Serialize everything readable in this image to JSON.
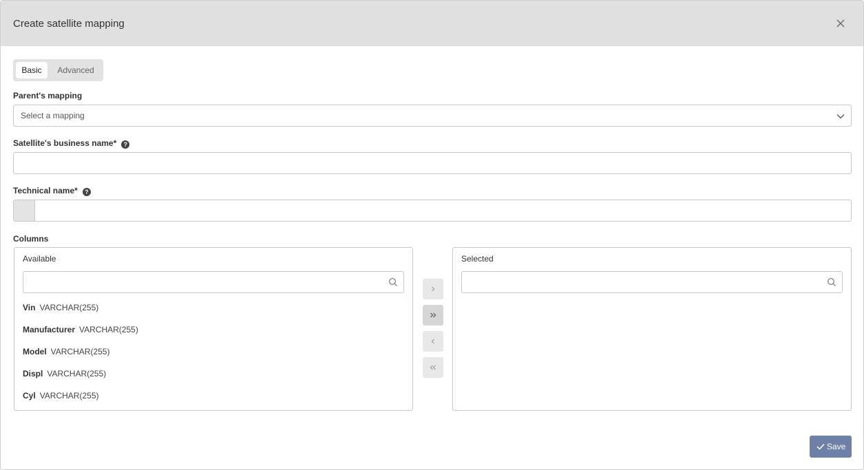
{
  "dialog": {
    "title": "Create satellite mapping",
    "close_icon": "close-icon"
  },
  "tabs": [
    {
      "label": "Basic",
      "active": true
    },
    {
      "label": "Advanced",
      "active": false
    }
  ],
  "fields": {
    "parent_mapping": {
      "label": "Parent's mapping",
      "placeholder": "Select a mapping",
      "value": ""
    },
    "business_name": {
      "label": "Satellite's business name*",
      "value": "",
      "help_icon": "?"
    },
    "technical_name": {
      "label": "Technical name*",
      "value": "",
      "help_icon": "?"
    }
  },
  "columns": {
    "label": "Columns",
    "available": {
      "title": "Available",
      "search_value": "",
      "items": [
        {
          "name": "Vin",
          "type": "VARCHAR(255)"
        },
        {
          "name": "Manufacturer",
          "type": "VARCHAR(255)"
        },
        {
          "name": "Model",
          "type": "VARCHAR(255)"
        },
        {
          "name": "Displ",
          "type": "VARCHAR(255)"
        },
        {
          "name": "Cyl",
          "type": "VARCHAR(255)"
        }
      ]
    },
    "selected": {
      "title": "Selected",
      "search_value": "",
      "items": []
    },
    "transfer_buttons": [
      {
        "icon": "chevron-right-icon"
      },
      {
        "icon": "double-chevron-right-icon"
      },
      {
        "icon": "chevron-left-icon"
      },
      {
        "icon": "double-chevron-left-icon"
      }
    ]
  },
  "footer": {
    "save_label": "Save",
    "save_icon": "check-icon"
  },
  "colors": {
    "header_bg": "#e0e0e0",
    "save_button": "#6e7fa8",
    "border": "#c8c8c8"
  }
}
